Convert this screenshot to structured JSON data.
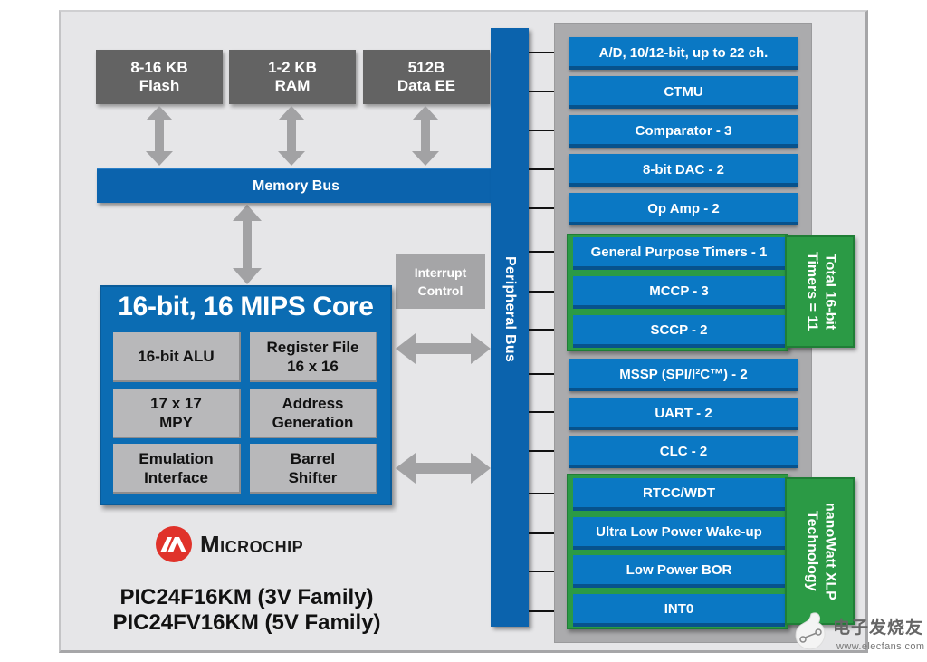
{
  "memory_blocks": [
    {
      "line1": "8-16 KB",
      "line2": "Flash"
    },
    {
      "line1": "1-2 KB",
      "line2": "RAM"
    },
    {
      "line1": "512B",
      "line2": "Data EE"
    }
  ],
  "memory_bus_label": "Memory Bus",
  "peripheral_bus_label": "Peripheral Bus",
  "interrupt_control": {
    "line1": "Interrupt",
    "line2": "Control"
  },
  "core": {
    "title": "16-bit, 16 MIPS Core",
    "blocks": [
      {
        "line1": "16-bit ALU",
        "line2": ""
      },
      {
        "line1": "Register File",
        "line2": "16 x 16"
      },
      {
        "line1": "17 x 17",
        "line2": "MPY"
      },
      {
        "line1": "Address",
        "line2": "Generation"
      },
      {
        "line1": "Emulation",
        "line2": "Interface"
      },
      {
        "line1": "Barrel",
        "line2": "Shifter"
      }
    ]
  },
  "brand": {
    "name": "Microchip",
    "logo_color": "#e0322a"
  },
  "families": [
    "PIC24F16KM (3V Family)",
    "PIC24FV16KM (5V Family)"
  ],
  "peripherals_analog": [
    "A/D, 10/12-bit, up to 22 ch.",
    "CTMU",
    "Comparator - 3",
    "8-bit DAC - 2",
    "Op Amp - 2"
  ],
  "timer_group": {
    "label": "Total 16-bit Timers = 11",
    "items": [
      "General Purpose Timers - 1",
      "MCCP - 3",
      "SCCP - 2"
    ]
  },
  "peripherals_comm": [
    "MSSP (SPI/I²C™) - 2",
    "UART - 2",
    "CLC - 2"
  ],
  "nanowatt_group": {
    "label": "nanoWatt XLP Technology",
    "items": [
      "RTCC/WDT",
      "Ultra Low Power Wake-up",
      "Low Power BOR",
      "INT0"
    ]
  },
  "watermark": {
    "text": "电子发烧友",
    "url": "www.elecfans.com"
  },
  "colors": {
    "blue": "#0a78c4",
    "bus_blue": "#0b63ad",
    "green": "#2b9a45",
    "memory_gray": "#636363",
    "core_block_gray": "#b8b8ba"
  }
}
